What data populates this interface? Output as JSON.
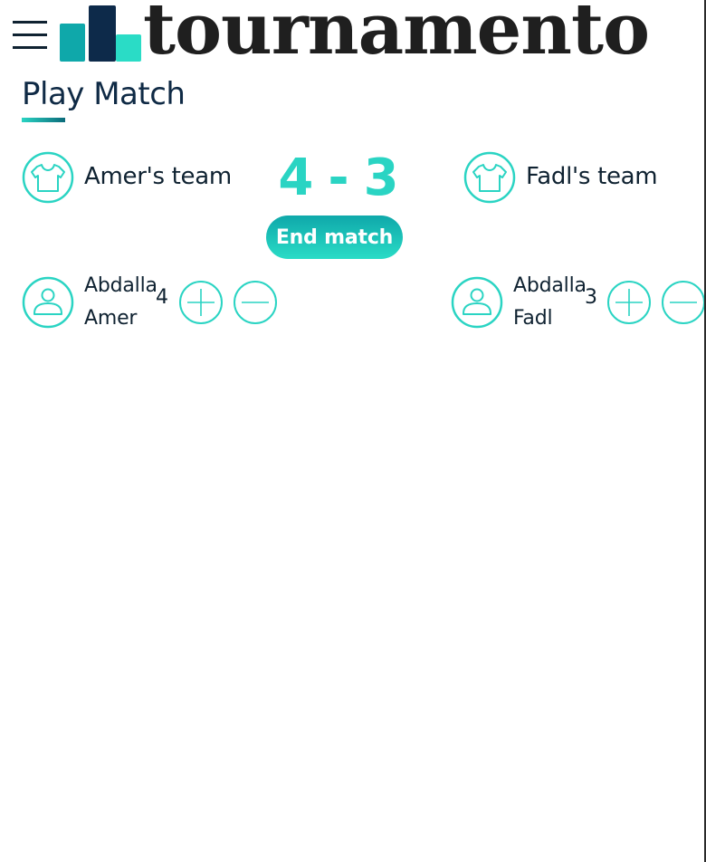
{
  "header": {
    "brand": "tournamento",
    "colors": {
      "bar1": "#0fa8aa",
      "bar2": "#0d2a4a",
      "bar3": "#2adcc6"
    }
  },
  "page": {
    "title": "Play Match"
  },
  "match": {
    "home_team": {
      "name": "Amer's team",
      "icon": "jersey-icon"
    },
    "away_team": {
      "name": "Fadl's team",
      "icon": "jersey-icon"
    },
    "home_score": "4",
    "separator": "-",
    "away_score": "3",
    "end_match_label": "End match"
  },
  "players": {
    "home": [
      {
        "first_name": "Abdalla",
        "last_name": "Amer",
        "goals": "4",
        "icon": "user-icon"
      }
    ],
    "away": [
      {
        "first_name": "Abdalla",
        "last_name": "Fadl",
        "goals": "3",
        "icon": "user-icon"
      }
    ]
  },
  "theme": {
    "accent": "#2ad4c3",
    "text": "#0f2231"
  }
}
